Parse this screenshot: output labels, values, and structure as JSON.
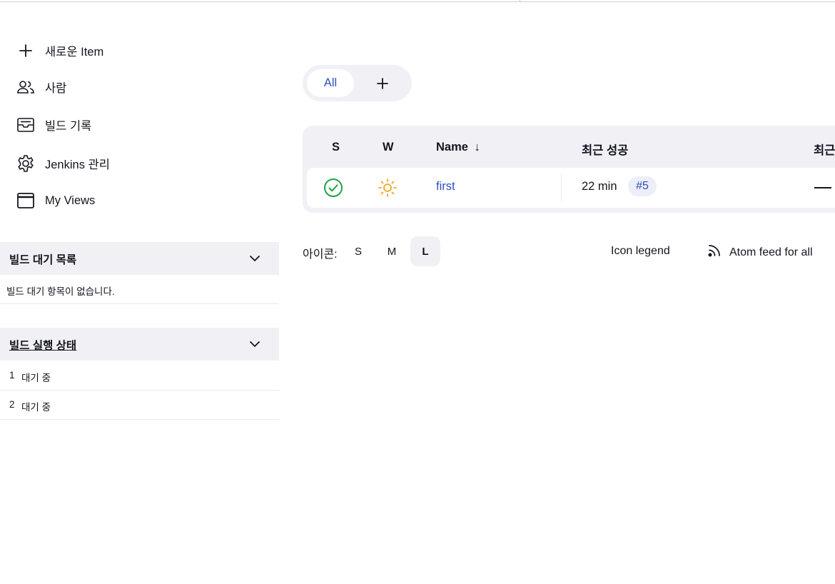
{
  "tasks": [
    {
      "label": "새로운 Item",
      "icon": "plus-icon"
    },
    {
      "label": "사람",
      "icon": "people-icon"
    },
    {
      "label": "빌드 기록",
      "icon": "inbox-icon"
    },
    {
      "label": "Jenkins 관리",
      "icon": "gear-icon"
    },
    {
      "label": "My Views",
      "icon": "window-icon"
    }
  ],
  "build_queue": {
    "title": "빌드 대기 목록",
    "empty_text": "빌드 대기 항목이 없습니다."
  },
  "executors": {
    "title": "빌드 실행 상태",
    "rows": [
      {
        "num": "1",
        "status": "대기 중"
      },
      {
        "num": "2",
        "status": "대기 중"
      }
    ]
  },
  "tabs": {
    "all_label": "All",
    "add_label": "+"
  },
  "table": {
    "headers": {
      "s": "S",
      "w": "W",
      "name": "Name",
      "name_sort": "↓",
      "last_success": "최근 성공",
      "last_failure": "최근"
    },
    "rows": [
      {
        "status_icon": "success-check-icon",
        "weather_icon": "sunny-icon",
        "name": "first",
        "last_success": "22 min",
        "build": "#5",
        "last_failure": "—"
      }
    ]
  },
  "footer": {
    "icon_label": "아이콘:",
    "sizes": [
      "S",
      "M",
      "L"
    ],
    "selected_size": "L",
    "legend": "Icon legend",
    "feed": "Atom feed for all"
  },
  "colors": {
    "link": "#2f4fc0",
    "success": "#1ea446",
    "weather": "#f5a623",
    "panel": "#f1f1f5"
  }
}
